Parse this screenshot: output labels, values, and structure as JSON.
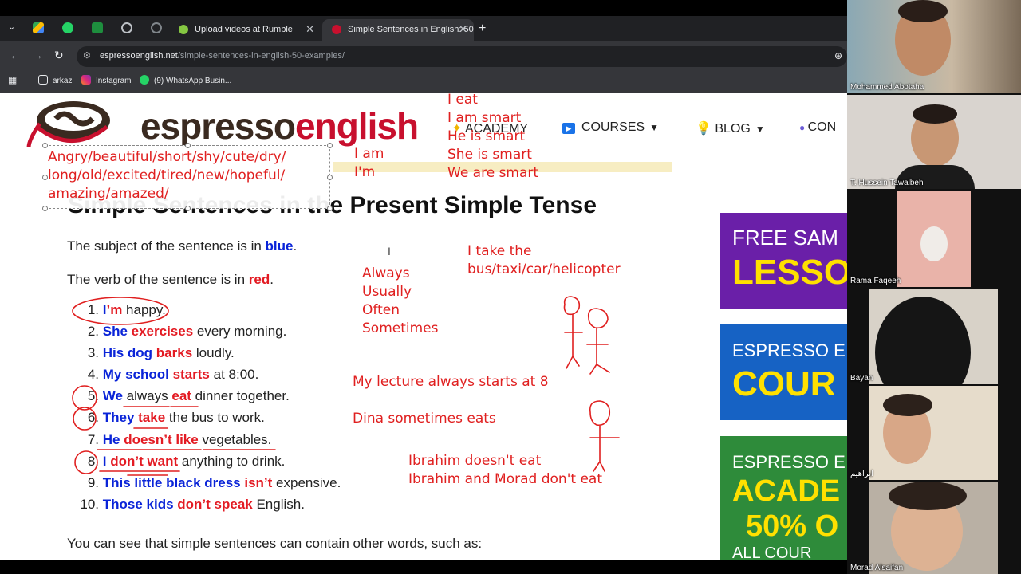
{
  "browser": {
    "tabs": [
      {
        "label": "Upload videos at Rumble",
        "close": "✕"
      },
      {
        "label": "Simple Sentences in English: 50",
        "close": "✕"
      }
    ],
    "new_tab": "+",
    "url_host": "espressoenglish.net",
    "url_path": "/simple-sentences-in-english-50-examples/",
    "bookmarks": [
      "arkaz",
      "Instagram",
      "(9) WhatsApp Busin..."
    ]
  },
  "site": {
    "logo_part1": "espresso",
    "logo_part2": "english",
    "nav": [
      {
        "label": "ACADEMY"
      },
      {
        "label": "COURSES"
      },
      {
        "label": "BLOG"
      },
      {
        "label": "CON"
      }
    ]
  },
  "article": {
    "title": "Simple Sentences in the Present Simple Tense",
    "subject_line": {
      "pre": "The subject of the sentence is in ",
      "color_word": "blue",
      "post": "."
    },
    "verb_line": {
      "pre": "The verb of the sentence is in ",
      "color_word": "red",
      "post": "."
    },
    "examples": [
      {
        "n": "1.",
        "s": "I",
        "v": "’m",
        "r": " happy."
      },
      {
        "n": "2.",
        "s": "She",
        "v": " exercises",
        "r": " every morning."
      },
      {
        "n": "3.",
        "s": "His dog",
        "v": " barks",
        "r": " loudly."
      },
      {
        "n": "4.",
        "s": "My school",
        "v": " starts",
        "r": " at 8:00."
      },
      {
        "n": "5.",
        "s": "We",
        "v2pre": " always ",
        "v": "eat",
        "r": " dinner together."
      },
      {
        "n": "6.",
        "s": "They",
        "v": " take",
        "r": " the bus to work."
      },
      {
        "n": "7.",
        "s": "He",
        "v": " doesn’t like",
        "r": " vegetables."
      },
      {
        "n": "8.",
        "s": "I",
        "v": " don’t want",
        "r": " anything to drink."
      },
      {
        "n": "9.",
        "s": "This little black dress",
        "v": " isn’t",
        "r": " expensive."
      },
      {
        "n": "10.",
        "s": "Those kids",
        "v": " don’t speak",
        "r": " English."
      }
    ],
    "footer_line": "You can see that simple sentences can contain other words, such as:"
  },
  "banners": [
    {
      "line1": "FREE SAM",
      "line2": "LESSO",
      "bg": "#6a1fa8"
    },
    {
      "line1": "ESPRESSO E",
      "line2": "COUR",
      "bg": "#1662c4"
    },
    {
      "line1": "ESPRESSO E",
      "line2": "ACADE",
      "line3": "50% O",
      "line4": "ALL COUR",
      "bg": "#2e8b3a"
    }
  ],
  "annotations": {
    "adjectives": [
      "Angry/beautiful/short/shy/cute/dry/",
      "long/old/excited/tired/new/hopeful/",
      "amazing/amazed/"
    ],
    "i_am": [
      "I am",
      "I'm"
    ],
    "she_is": [
      "I eat",
      "I am smart",
      "He is smart",
      "She is smart",
      "We are smart"
    ],
    "frequency": [
      "Always",
      "Usually",
      "Often",
      "Sometimes"
    ],
    "take": [
      "I take the",
      "bus/taxi/car/helicopter"
    ],
    "lecture": "My lecture always starts at 8",
    "dina": "Dina sometimes eats",
    "ibrahim": [
      "Ibrahim doesn't eat",
      "Ibrahim and Morad don't eat"
    ]
  },
  "participants": [
    {
      "name": "Mohammed Abotaha"
    },
    {
      "name": "T. Hussein Tawalbeh"
    },
    {
      "name": "Rama Faqeeh"
    },
    {
      "name": "Bayan"
    },
    {
      "name": "ابراهيم"
    },
    {
      "name": "Morad Alsaifan"
    }
  ],
  "colors": {
    "accent_red": "#e31b23",
    "accent_blue": "#0a24d8",
    "ink": "#e02020"
  }
}
